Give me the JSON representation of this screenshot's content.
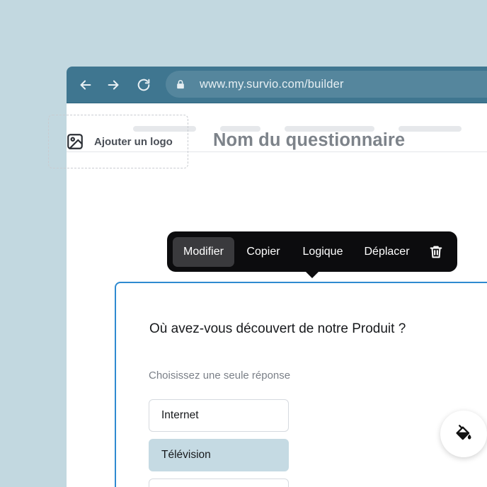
{
  "browser": {
    "url": "www.my.survio.com/builder",
    "back_icon": "arrow-left-icon",
    "forward_icon": "arrow-right-icon",
    "reload_icon": "reload-icon",
    "lock_icon": "lock-icon"
  },
  "builder": {
    "logo_label": "Ajouter un logo",
    "form_title": "Nom du questionnaire"
  },
  "action_menu": {
    "items": [
      {
        "label": "Modifier",
        "active": true
      },
      {
        "label": "Copier"
      },
      {
        "label": "Logique"
      },
      {
        "label": "Déplacer"
      }
    ],
    "delete_icon": "trash-icon"
  },
  "question_card": {
    "question": "Où avez-vous découvert de notre Produit ?",
    "hint": "Choisissez une seule réponse",
    "options": [
      {
        "label": "Internet",
        "selected": false
      },
      {
        "label": "Télévision",
        "selected": true
      },
      {
        "label": "",
        "selected": false
      }
    ]
  },
  "fab": {
    "icon": "paint-bucket-icon"
  },
  "colors": {
    "background": "#c2d8e0",
    "chrome": "#3f7690",
    "url_bar": "#55869d",
    "accent_border": "#2e8ad0",
    "selected_option": "#c5dae3",
    "menu_bg": "#0c0c0e"
  }
}
